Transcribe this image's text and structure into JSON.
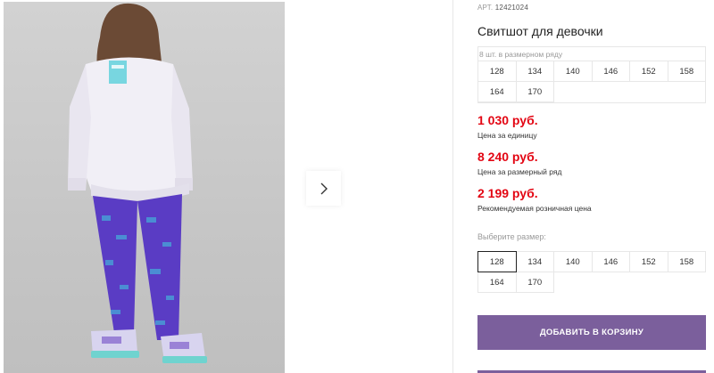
{
  "product": {
    "article_label": "АРТ.",
    "article_number": "12421024",
    "title": "Свитшот для девочки"
  },
  "size_row": {
    "caption": "8 шт. в размерном ряду",
    "sizes": [
      "128",
      "134",
      "140",
      "146",
      "152",
      "158",
      "164",
      "170"
    ]
  },
  "prices": {
    "unit_price": "1 030 руб.",
    "unit_label": "Цена за единицу",
    "row_price": "8 240 руб.",
    "row_label": "Цена за размерный ряд",
    "retail_price": "2 199 руб.",
    "retail_label": "Рекомендуемая розничная цена"
  },
  "size_select": {
    "label": "Выберите размер:",
    "sizes": [
      "128",
      "134",
      "140",
      "146",
      "152",
      "158",
      "164",
      "170"
    ],
    "selected": "128"
  },
  "cart": {
    "button_label": "ДОБАВИТЬ В КОРЗИНУ"
  },
  "icons": {
    "next": "chevron-right-icon"
  },
  "colors": {
    "price_red": "#e30613",
    "button_purple": "#7b5f9c"
  }
}
